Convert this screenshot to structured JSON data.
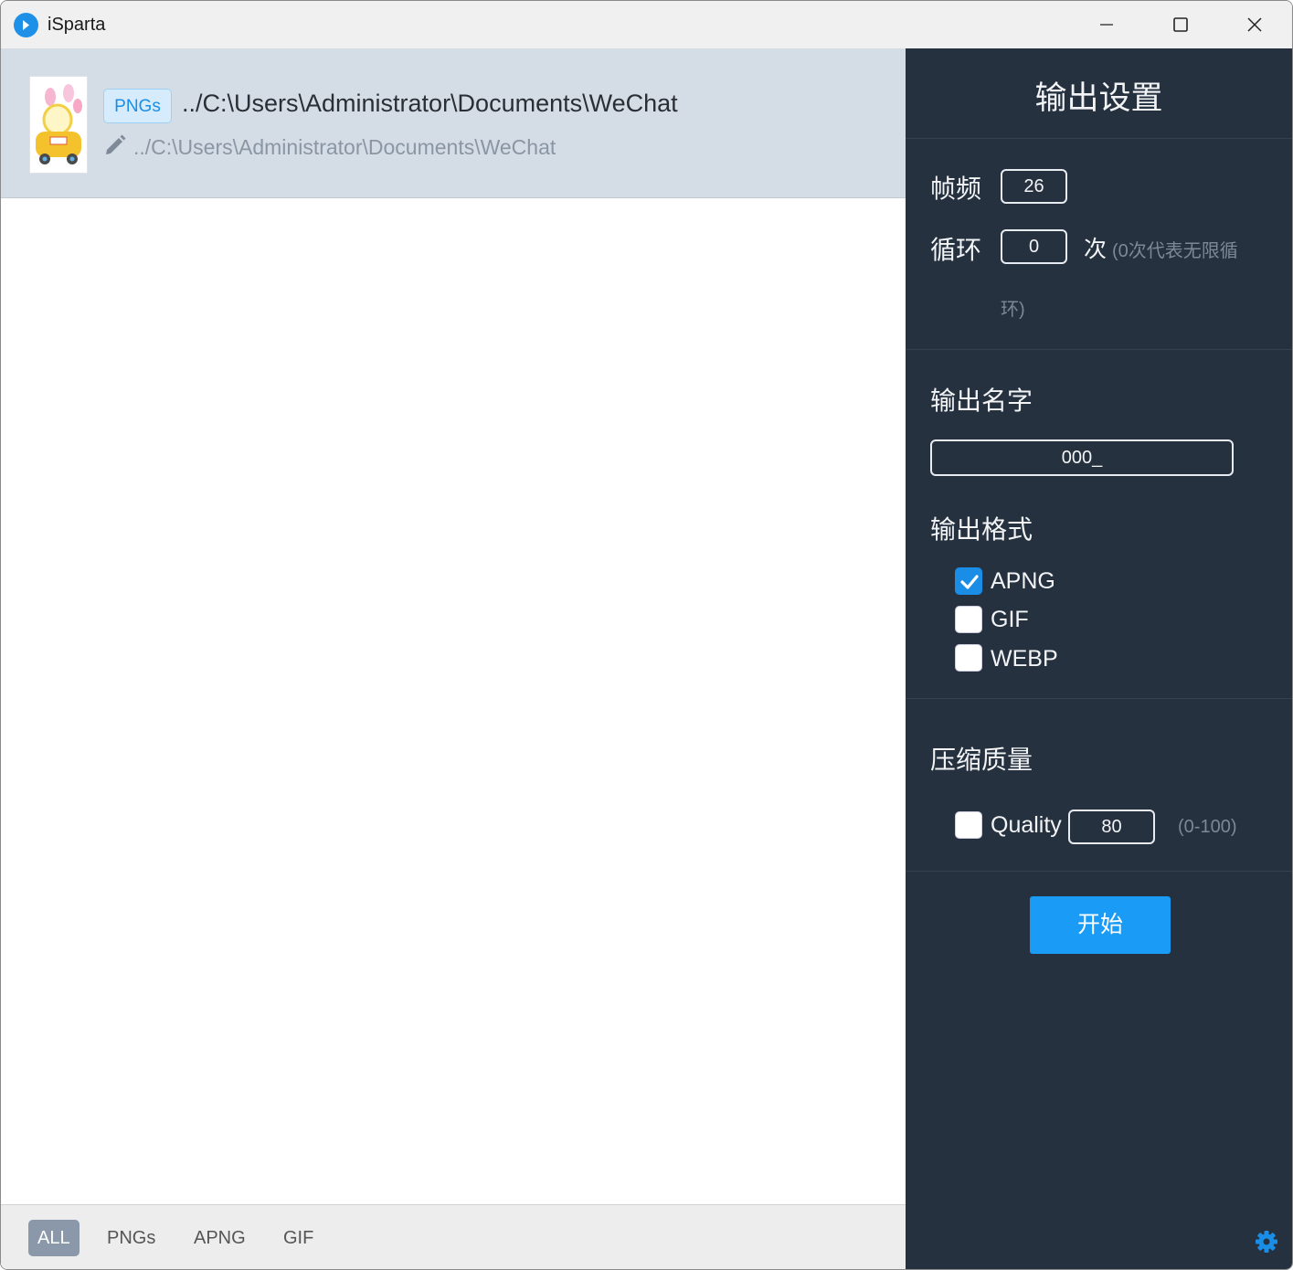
{
  "window": {
    "title": "iSparta",
    "controls": [
      "minimize-icon",
      "maximize-icon",
      "close-icon"
    ]
  },
  "file_list": {
    "items": [
      {
        "type_tag": "PNGs",
        "path": "../C:\\Users\\Administrator\\Documents\\WeChat",
        "output_path": "../C:\\Users\\Administrator\\Documents\\WeChat",
        "thumbnail_icon": "image-thumbnail-icon"
      }
    ]
  },
  "filters": {
    "items": [
      "ALL",
      "PNGs",
      "APNG",
      "GIF"
    ],
    "active": "ALL"
  },
  "settings": {
    "title": "输出设置",
    "frame_rate_label": "帧频",
    "frame_rate_value": "26",
    "loop_label": "循环",
    "loop_value": "0",
    "loop_unit": "次",
    "loop_hint_line1": "(0次代表无限循",
    "loop_hint_line2": "环)",
    "output_name_label": "输出名字",
    "output_name_value": "000_",
    "output_format_label": "输出格式",
    "formats": [
      {
        "label": "APNG",
        "checked": true
      },
      {
        "label": "GIF",
        "checked": false
      },
      {
        "label": "WEBP",
        "checked": false
      }
    ],
    "quality_section_label": "压缩质量",
    "quality_label": "Quality",
    "quality_checked": false,
    "quality_value": "80",
    "quality_hint": "(0-100)",
    "start_label": "开始"
  },
  "colors": {
    "accent": "#1a9bf5",
    "panel_bg": "#263140",
    "selected_row_bg": "#d4dce6"
  }
}
